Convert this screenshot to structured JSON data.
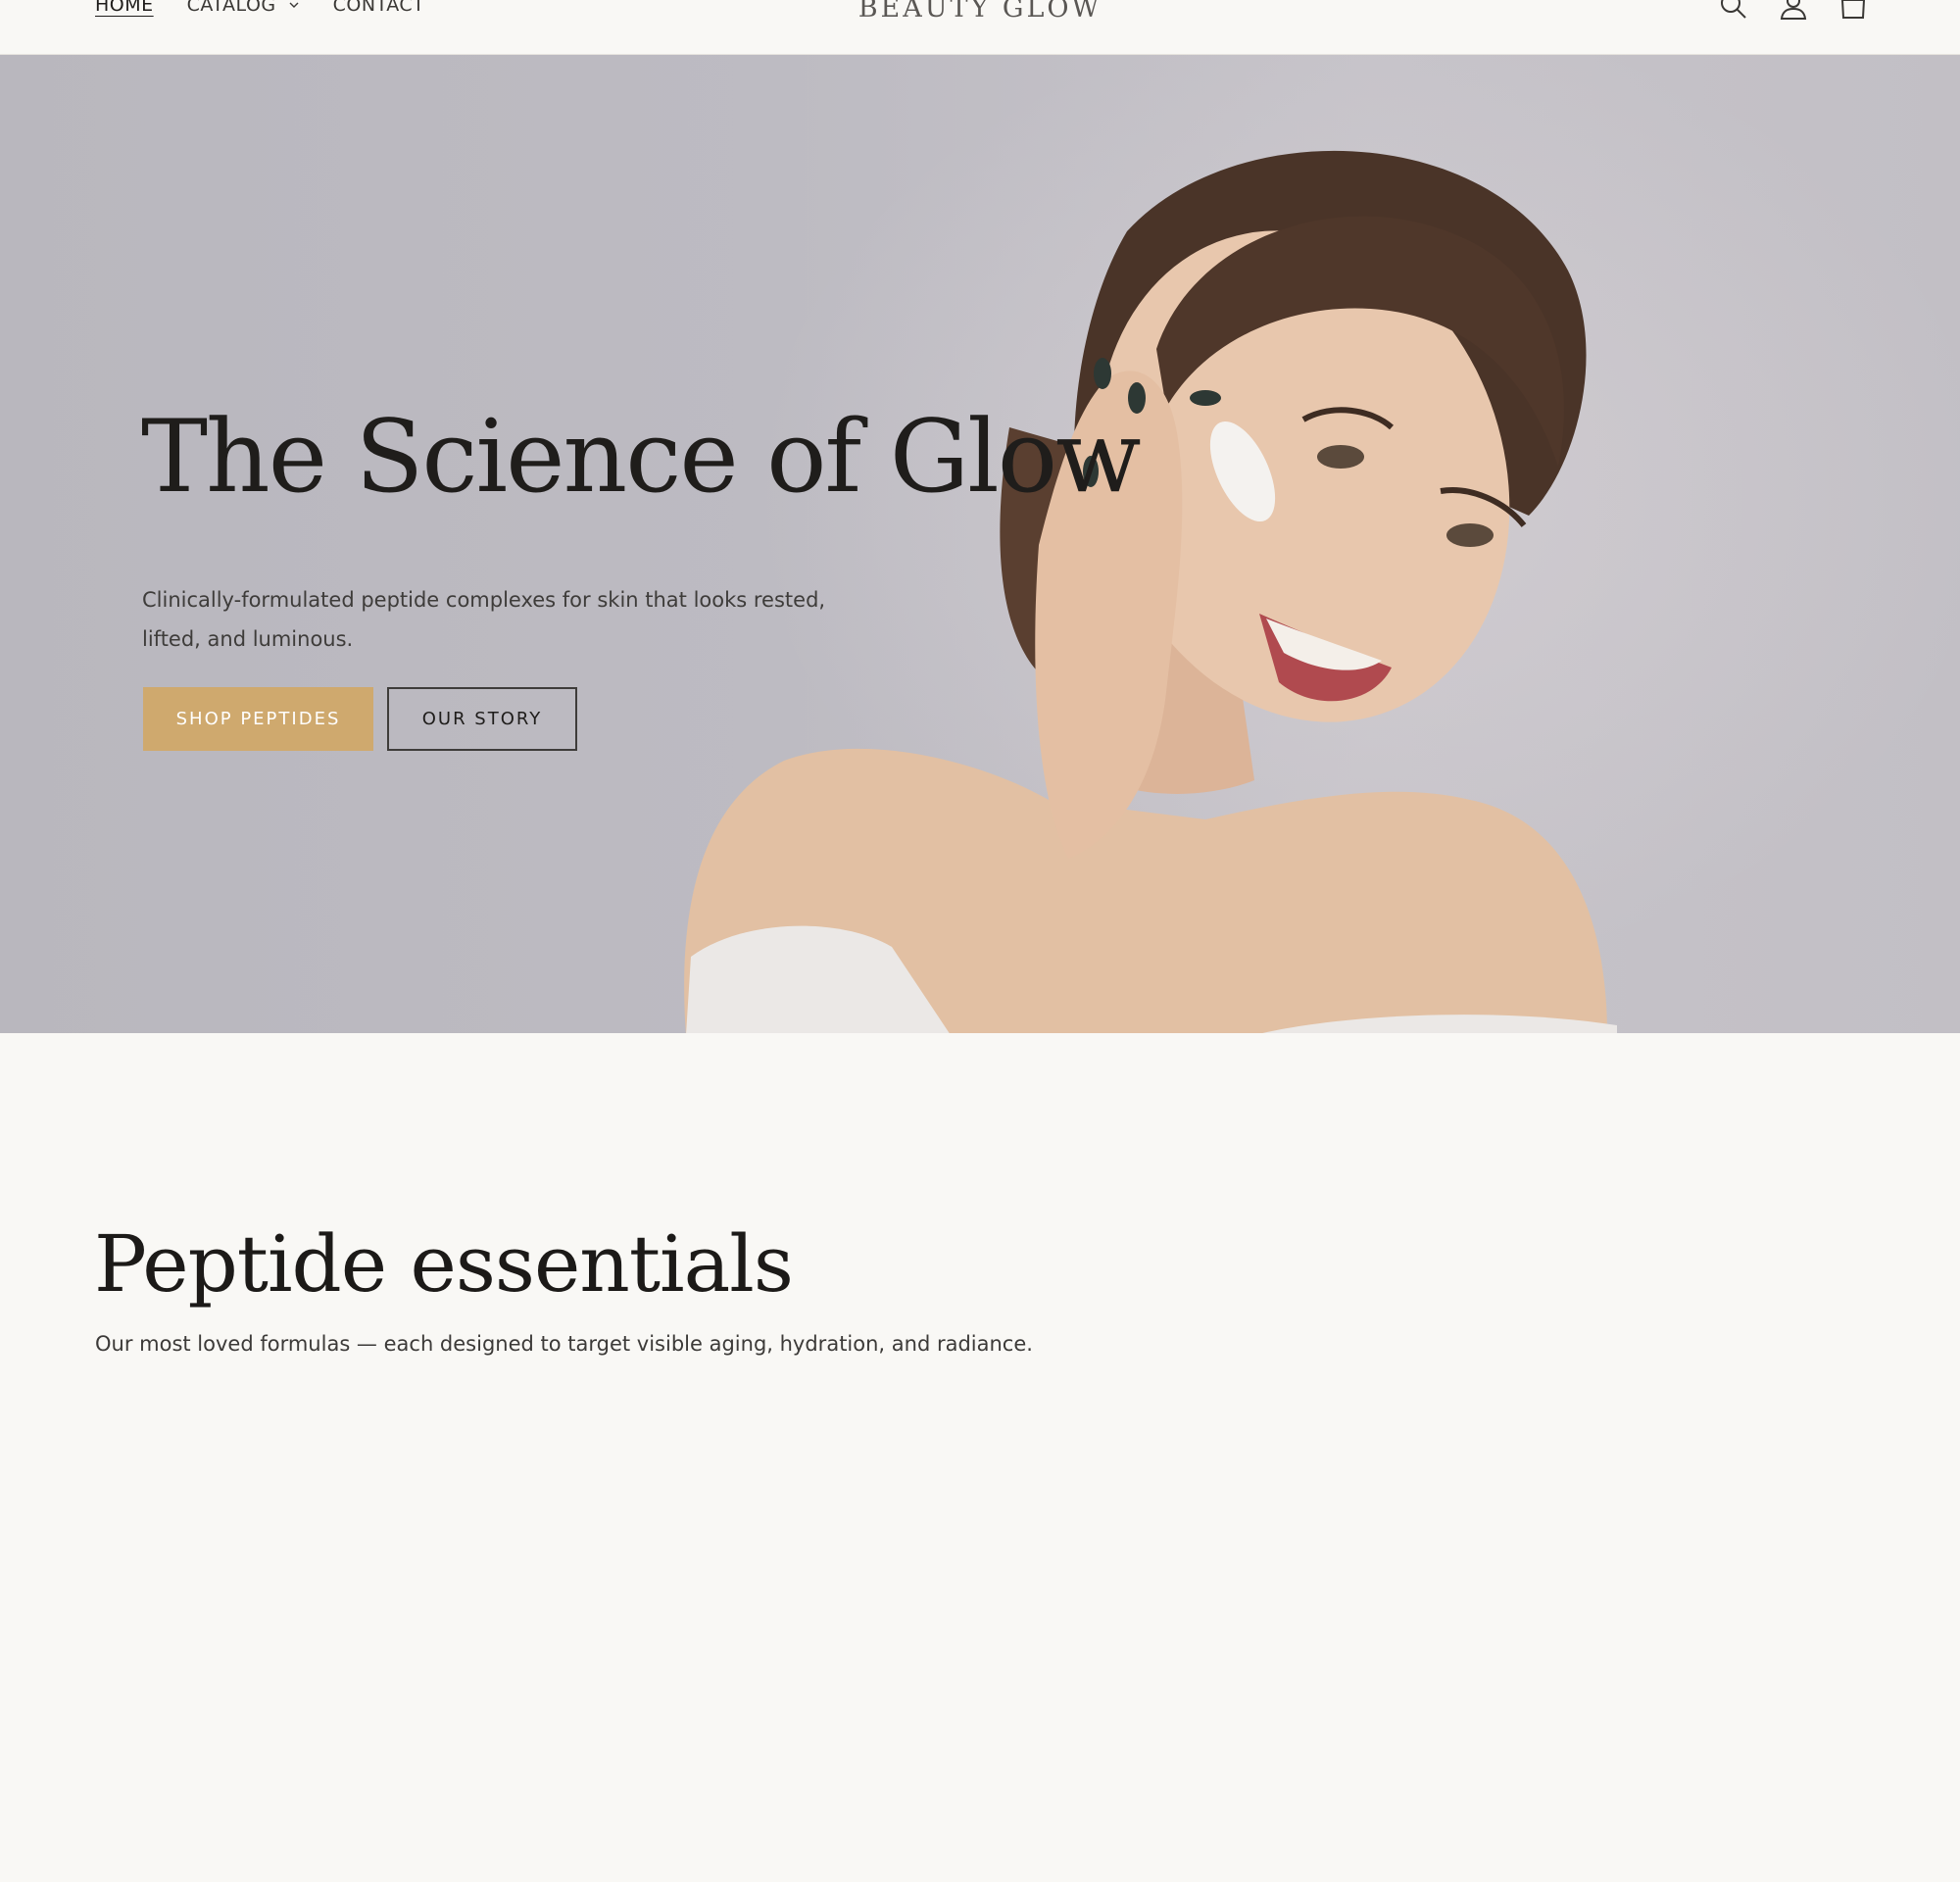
{
  "header": {
    "nav": [
      {
        "label": "HOME",
        "active": true
      },
      {
        "label": "CATALOG",
        "has_dropdown": true
      },
      {
        "label": "CONTACT"
      }
    ],
    "logo": "BEAUTY GLOW",
    "icons": [
      "search-icon",
      "account-icon",
      "cart-icon"
    ]
  },
  "hero": {
    "title": "The Science of Glow",
    "subtitle": "Clinically-formulated peptide complexes for skin that looks rested, lifted, and luminous.",
    "primary_button": "SHOP PEPTIDES",
    "secondary_button": "OUR STORY"
  },
  "featured": {
    "title": "Peptide essentials",
    "subtitle": "Our most loved formulas — each designed to target visible aging, hydration, and radiance."
  },
  "colors": {
    "accent": "#cfa96e",
    "background": "#f9f8f5",
    "text": "#1f1d1b"
  }
}
